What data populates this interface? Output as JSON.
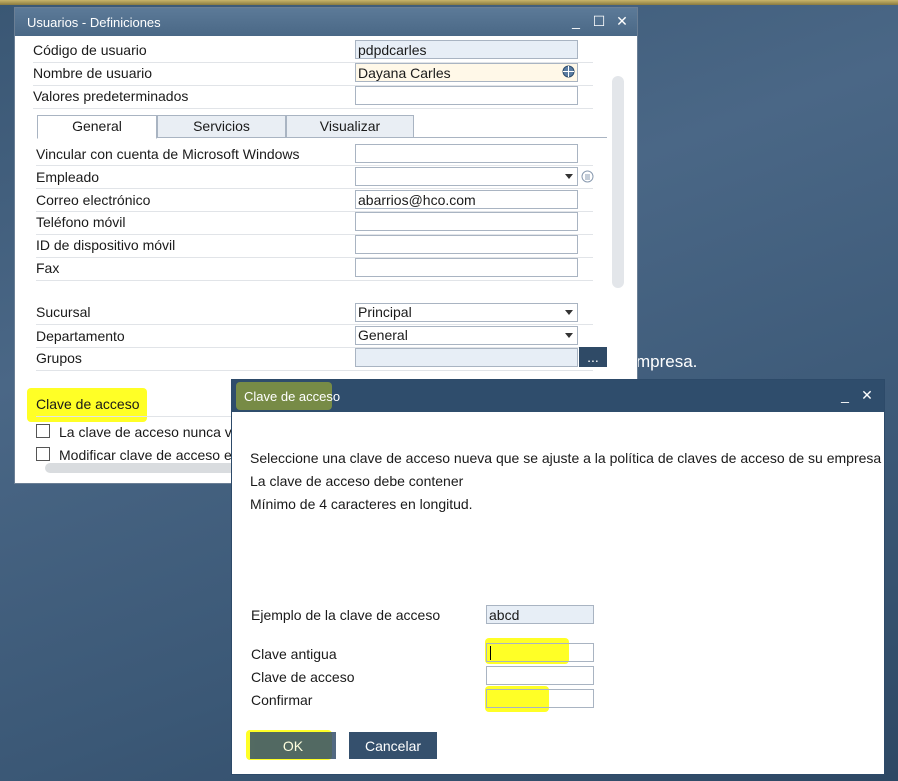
{
  "main_window": {
    "title": "Usuarios - Definiciones",
    "fields": {
      "user_code": {
        "label": "Código de usuario",
        "value": "pdpdcarles"
      },
      "user_name": {
        "label": "Nombre de usuario",
        "value": "Dayana Carles"
      },
      "defaults": {
        "label": "Valores predeterminados",
        "value": ""
      }
    },
    "tabs": [
      {
        "label": "General",
        "active": true
      },
      {
        "label": "Servicios",
        "active": false
      },
      {
        "label": "Visualizar",
        "active": false
      }
    ],
    "general": {
      "windows_account": {
        "label": "Vincular con cuenta de Microsoft Windows",
        "value": ""
      },
      "employee": {
        "label": "Empleado",
        "value": ""
      },
      "email": {
        "label": "Correo electrónico",
        "value": "abarrios@hco.com"
      },
      "mobile": {
        "label": "Teléfono móvil",
        "value": ""
      },
      "device_id": {
        "label": "ID de dispositivo móvil",
        "value": ""
      },
      "fax": {
        "label": "Fax",
        "value": ""
      },
      "branch": {
        "label": "Sucursal",
        "value": "Principal"
      },
      "department": {
        "label": "Departamento",
        "value": "General"
      },
      "groups": {
        "label": "Grupos",
        "value": "",
        "button": "..."
      }
    },
    "password_section": {
      "label": "Clave de acceso",
      "never_expires": "La clave de acceso nunca ve",
      "change_next": "Modificar clave de acceso en"
    }
  },
  "background_text": "mpresa.",
  "dialog": {
    "title": "Clave de acceso",
    "messages": [
      "Seleccione una clave de acceso nueva que se ajuste a la política de claves de acceso de su empresa",
      "La clave de acceso debe contener",
      "Mínimo de 4 caracteres en longitud."
    ],
    "example": {
      "label": "Ejemplo de la clave de acceso",
      "value": "abcd"
    },
    "old_password": {
      "label": "Clave antigua",
      "value": ""
    },
    "password": {
      "label": "Clave de acceso",
      "value": ""
    },
    "confirm": {
      "label": "Confirmar",
      "value": ""
    },
    "ok_label": "OK",
    "cancel_label": "Cancelar"
  },
  "colors": {
    "desktop": "#3f5c7a",
    "titlebar": "#4f6d8c",
    "dialog_titlebar": "#2f4d6c",
    "highlight": "#ffff00",
    "readonly_field": "#e7eef6"
  }
}
